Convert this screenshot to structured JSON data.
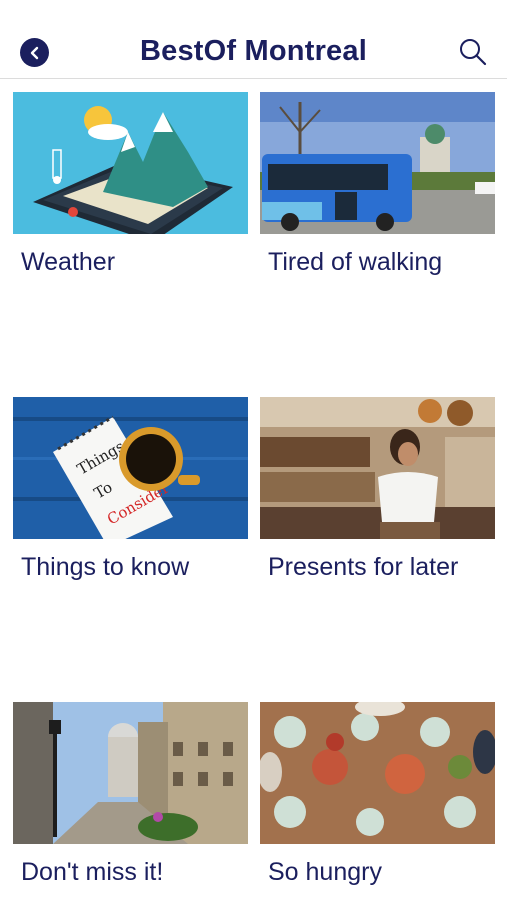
{
  "header": {
    "title": "BestOf Montreal",
    "back_icon": "chevron-left-icon",
    "search_icon": "search-icon"
  },
  "colors": {
    "brand": "#1b1f5e",
    "divider": "#dcdcdc",
    "background": "#ffffff"
  },
  "cards": [
    {
      "label": "Weather",
      "image": "weather-tablet-illustration"
    },
    {
      "label": "Tired of walking",
      "image": "city-bus-photo"
    },
    {
      "label": "Things to know",
      "image": "things-to-consider-notepad-photo"
    },
    {
      "label": "Presents for later",
      "image": "market-shop-photo"
    },
    {
      "label": "Don't miss it!",
      "image": "old-montreal-street-photo"
    },
    {
      "label": "So hungry",
      "image": "shared-meal-table-photo"
    }
  ]
}
